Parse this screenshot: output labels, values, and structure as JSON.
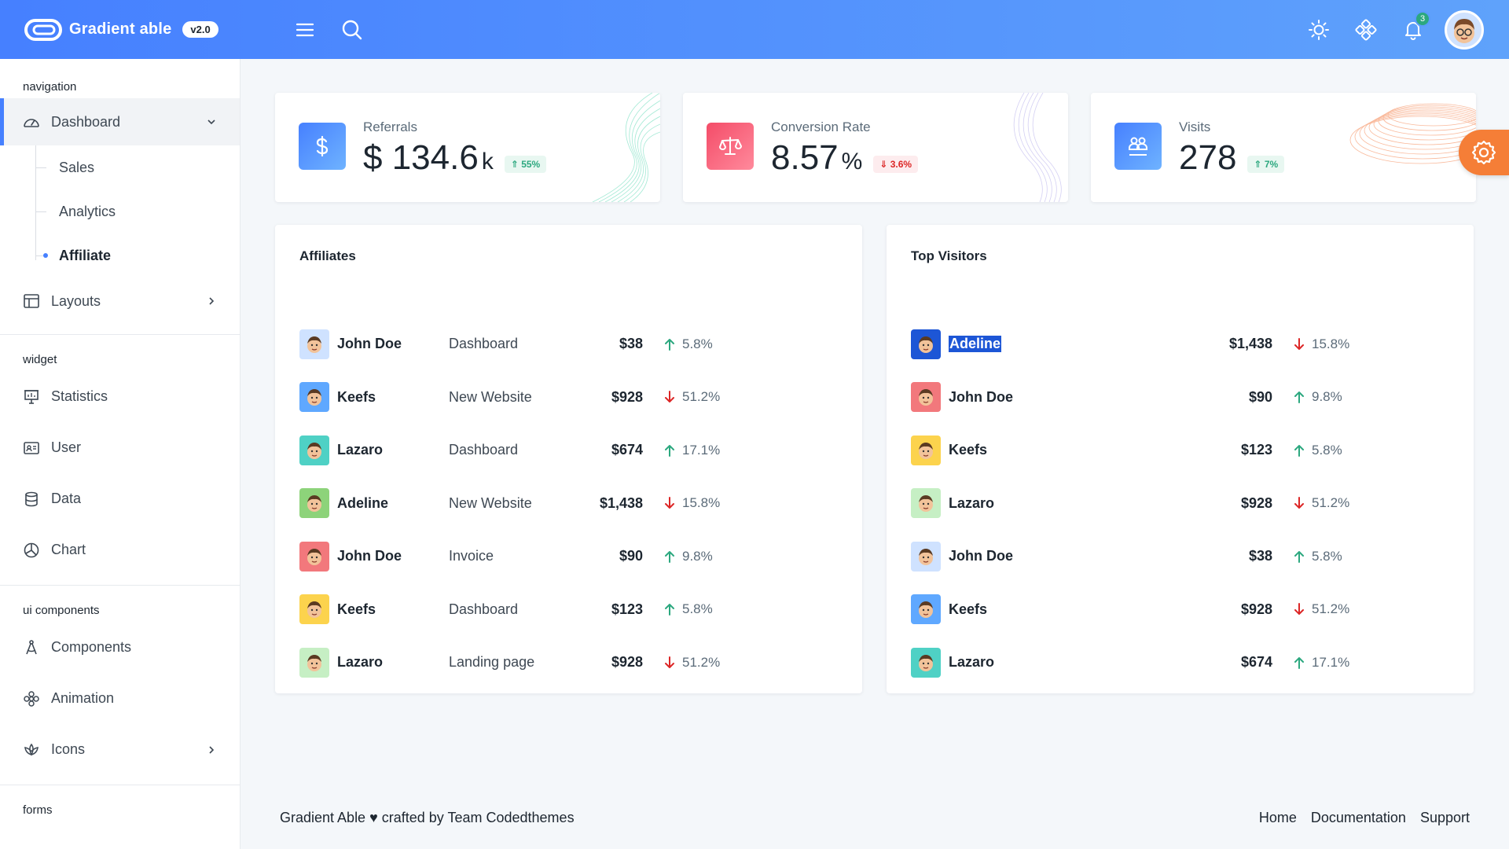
{
  "brand": {
    "name": "Gradient able",
    "version": "v2.0"
  },
  "header": {
    "notification_count": "3"
  },
  "sidebar": {
    "caption_navigation": "navigation",
    "dashboard": "Dashboard",
    "sub_items": [
      "Sales",
      "Analytics",
      "Affiliate"
    ],
    "layouts": "Layouts",
    "caption_widget": "widget",
    "widget_items": [
      "Statistics",
      "User",
      "Data",
      "Chart"
    ],
    "caption_ui": "ui components",
    "ui_items": [
      "Components",
      "Animation",
      "Icons"
    ],
    "caption_forms": "forms"
  },
  "stats": [
    {
      "label": "Referrals",
      "value": "$ 134.6",
      "unit": "k",
      "badge": "55%",
      "trend": "up",
      "color": "#4680ff"
    },
    {
      "label": "Conversion Rate",
      "value": "8.57",
      "unit": "%",
      "badge": "3.6%",
      "trend": "down",
      "color": "#f44c68"
    },
    {
      "label": "Visits",
      "value": "278",
      "unit": "",
      "badge": "7%",
      "trend": "up",
      "color": "#4680ff"
    }
  ],
  "affiliates": {
    "title": "Affiliates",
    "rows": [
      {
        "name": "John Doe",
        "site": "Dashboard",
        "amount": "$38",
        "pct": "5.8%",
        "trend": "up"
      },
      {
        "name": "Keefs",
        "site": "New Website",
        "amount": "$928",
        "pct": "51.2%",
        "trend": "down"
      },
      {
        "name": "Lazaro",
        "site": "Dashboard",
        "amount": "$674",
        "pct": "17.1%",
        "trend": "up"
      },
      {
        "name": "Adeline",
        "site": "New Website",
        "amount": "$1,438",
        "pct": "15.8%",
        "trend": "down"
      },
      {
        "name": "John Doe",
        "site": "Invoice",
        "amount": "$90",
        "pct": "9.8%",
        "trend": "up"
      },
      {
        "name": "Keefs",
        "site": "Dashboard",
        "amount": "$123",
        "pct": "5.8%",
        "trend": "up"
      },
      {
        "name": "Lazaro",
        "site": "Landing page",
        "amount": "$928",
        "pct": "51.2%",
        "trend": "down"
      }
    ]
  },
  "top_visitors": {
    "title": "Top Visitors",
    "rows": [
      {
        "name": "Adeline",
        "amount": "$1,438",
        "pct": "15.8%",
        "trend": "down"
      },
      {
        "name": "John Doe",
        "amount": "$90",
        "pct": "9.8%",
        "trend": "up"
      },
      {
        "name": "Keefs",
        "amount": "$123",
        "pct": "5.8%",
        "trend": "up"
      },
      {
        "name": "Lazaro",
        "amount": "$928",
        "pct": "51.2%",
        "trend": "down"
      },
      {
        "name": "John Doe",
        "amount": "$38",
        "pct": "5.8%",
        "trend": "up"
      },
      {
        "name": "Keefs",
        "amount": "$928",
        "pct": "51.2%",
        "trend": "down"
      },
      {
        "name": "Lazaro",
        "amount": "$674",
        "pct": "17.1%",
        "trend": "up"
      }
    ]
  },
  "footer": {
    "credit": "Gradient Able ♥ crafted by Team Codedthemes",
    "links": [
      "Home",
      "Documentation",
      "Support"
    ]
  },
  "colors": {
    "primary": "#4680ff",
    "success": "#2ca87f",
    "danger": "#dc2626",
    "warning": "#f57e37"
  }
}
